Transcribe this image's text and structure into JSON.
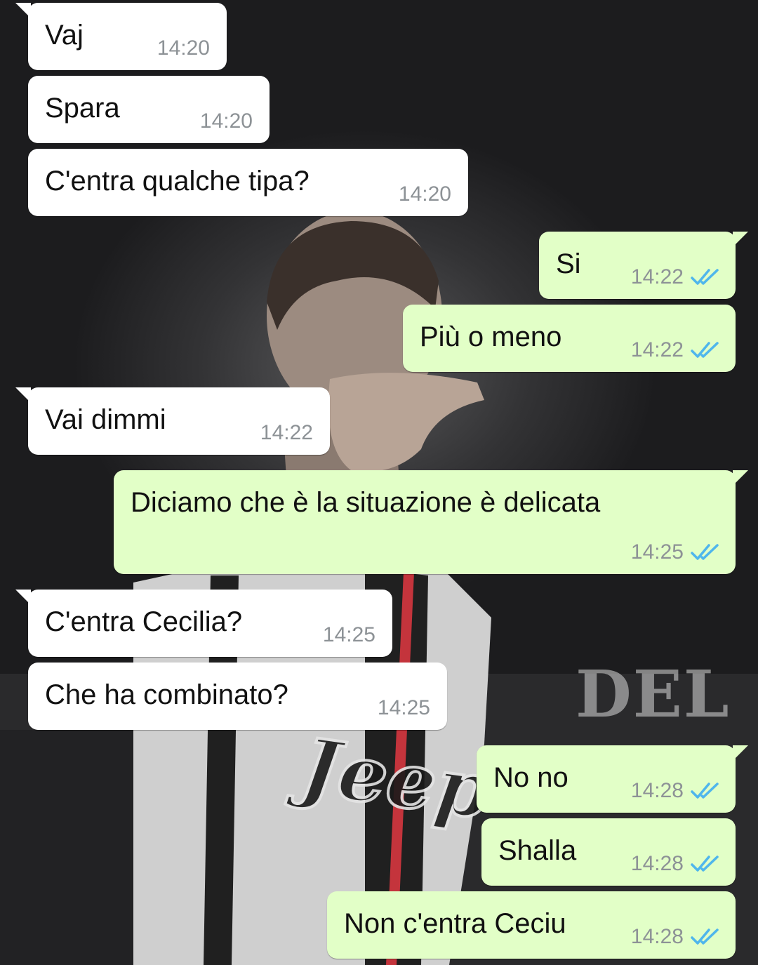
{
  "colors": {
    "incoming_bubble": "#ffffff",
    "outgoing_bubble": "#e2ffc7",
    "read_ticks": "#4fb6ec",
    "time_text": "#8d9296"
  },
  "wallpaper": {
    "stadium_text": "DEL",
    "jersey_text": "Jeep"
  },
  "messages": [
    {
      "direction": "in",
      "text": "Vaj",
      "time": "14:20"
    },
    {
      "direction": "in",
      "text": "Spara",
      "time": "14:20"
    },
    {
      "direction": "in",
      "text": "C'entra qualche tipa?",
      "time": "14:20"
    },
    {
      "direction": "out",
      "text": "Si",
      "time": "14:22",
      "status": "read"
    },
    {
      "direction": "out",
      "text": "Più o meno",
      "time": "14:22",
      "status": "read"
    },
    {
      "direction": "in",
      "text": "Vai dimmi",
      "time": "14:22"
    },
    {
      "direction": "out",
      "text": "Diciamo che è la situazione è delicata",
      "time": "14:25",
      "status": "read"
    },
    {
      "direction": "in",
      "text": "C'entra Cecilia?",
      "time": "14:25"
    },
    {
      "direction": "in",
      "text": "Che ha combinato?",
      "time": "14:25"
    },
    {
      "direction": "out",
      "text": "No no",
      "time": "14:28",
      "status": "read"
    },
    {
      "direction": "out",
      "text": "Shalla",
      "time": "14:28",
      "status": "read"
    },
    {
      "direction": "out",
      "text": "Non c'entra Ceciu",
      "time": "14:28",
      "status": "read"
    }
  ]
}
